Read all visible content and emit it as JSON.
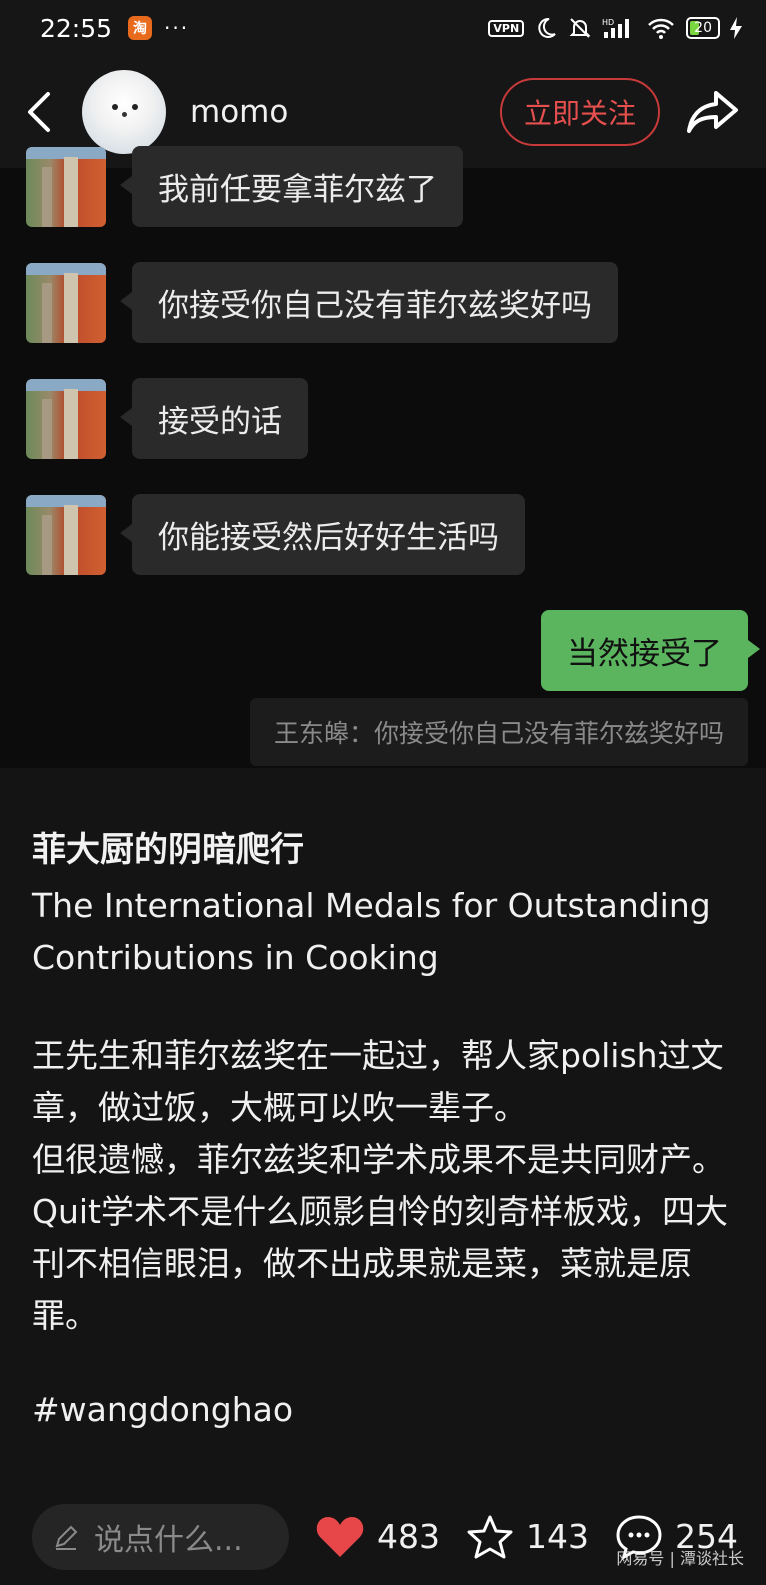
{
  "status_bar": {
    "time": "22:55",
    "app_icon_label": "淘",
    "more": "···",
    "vpn": "VPN",
    "battery": "20"
  },
  "header": {
    "username": "momo",
    "follow_label": "立即关注"
  },
  "chat": {
    "messages": [
      {
        "text": "我前任要拿菲尔兹了"
      },
      {
        "text": "你接受你自己没有菲尔兹奖好吗"
      },
      {
        "text": "接受的话"
      },
      {
        "text": "你能接受然后好好生活吗"
      }
    ],
    "reply": "当然接受了",
    "quote": "王东皞：你接受你自己没有菲尔兹奖好吗"
  },
  "post": {
    "title": "菲大厨的阴暗爬行",
    "subtitle": "The International Medals for Outstanding Contributions in Cooking",
    "body": [
      "王先生和菲尔兹奖在一起过，帮人家polish过文章，做过饭，大概可以吹一辈子。",
      "但很遗憾，菲尔兹奖和学术成果不是共同财产。",
      "Quit学术不是什么顾影自怜的刻奇样板戏，四大刊不相信眼泪，做不出成果就是菜，菜就是原罪。"
    ],
    "tag": "#wangdonghao"
  },
  "bottom_bar": {
    "comment_placeholder": "说点什么...",
    "likes": "483",
    "stars": "143",
    "comments": "254"
  },
  "watermark": "网易号 | 潭谈社长",
  "colors": {
    "follow": "#e5504f",
    "reply_bubble": "#5ab55e",
    "heart": "#e8474a",
    "background": "#111111"
  },
  "icons": [
    "back-arrow-icon",
    "share-icon",
    "pencil-icon",
    "heart-icon",
    "star-icon",
    "comment-icon"
  ]
}
